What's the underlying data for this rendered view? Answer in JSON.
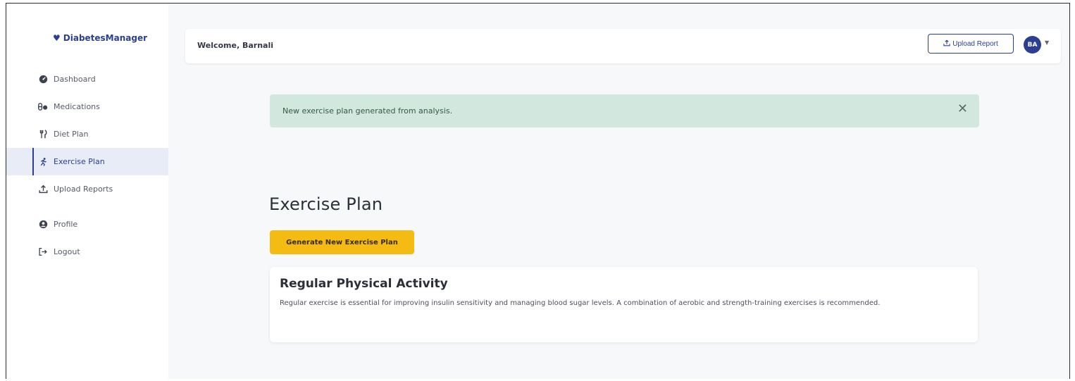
{
  "brand": {
    "name": "DiabetesManager",
    "icon": "heart-pulse-icon"
  },
  "sidebar": {
    "items": [
      {
        "label": "Dashboard",
        "icon": "dashboard-icon",
        "active": false
      },
      {
        "label": "Medications",
        "icon": "pills-icon",
        "active": false
      },
      {
        "label": "Diet Plan",
        "icon": "utensils-icon",
        "active": false
      },
      {
        "label": "Exercise Plan",
        "icon": "running-icon",
        "active": true
      },
      {
        "label": "Upload Reports",
        "icon": "upload-icon",
        "active": false
      },
      {
        "label": "Profile",
        "icon": "user-circle-icon",
        "active": false
      },
      {
        "label": "Logout",
        "icon": "logout-icon",
        "active": false
      }
    ]
  },
  "header": {
    "welcome": "Welcome, Barnali",
    "upload_label": "Upload Report",
    "avatar_initials": "BA"
  },
  "alert": {
    "message": "New exercise plan generated from analysis.",
    "close_glyph": "✕"
  },
  "main": {
    "title": "Exercise Plan",
    "generate_label": "Generate New Exercise Plan",
    "card": {
      "title": "Regular Physical Activity",
      "text": "Regular exercise is essential for improving insulin sensitivity and managing blood sugar levels. A combination of aerobic and strength-training exercises is recommended."
    }
  },
  "colors": {
    "primary": "#2c3e91",
    "accent_button": "#f4bb12",
    "alert_bg": "#d2e8de",
    "active_nav_bg": "#e8ecf6"
  }
}
